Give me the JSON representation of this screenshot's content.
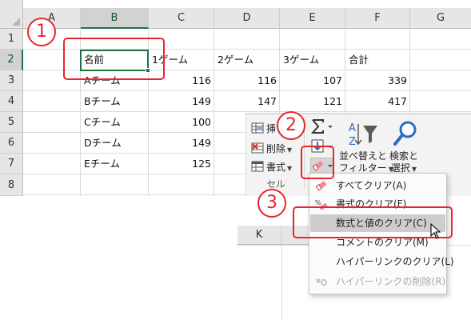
{
  "sheet": {
    "columns": [
      "A",
      "B",
      "C",
      "D",
      "E",
      "F",
      "G"
    ],
    "rows": [
      "1",
      "2",
      "3",
      "4",
      "5",
      "6",
      "7",
      "8"
    ],
    "header_row": [
      "名前",
      "1ゲーム",
      "2ゲーム",
      "3ゲーム",
      "合計"
    ],
    "data": [
      [
        "Aチーム",
        "116",
        "116",
        "107",
        "339"
      ],
      [
        "Bチーム",
        "149",
        "147",
        "121",
        "417"
      ],
      [
        "Cチーム",
        "100"
      ],
      [
        "Dチーム",
        "149"
      ],
      [
        "Eチーム",
        "125"
      ]
    ],
    "selected_column": "B",
    "selected_row": "2"
  },
  "ribbon": {
    "insert_label": "挿",
    "delete_label": "削除",
    "format_label": "書式",
    "group_label": "セル",
    "autosum_icon": "sigma-icon",
    "fill_icon": "fill-down-icon",
    "clear_icon": "eraser-icon",
    "sort_filter_label_1": "並べ替えと",
    "sort_filter_label_2": "フィルター",
    "find_select_label_1": "検索と",
    "find_select_label_2": "選択"
  },
  "clear_menu": {
    "items": [
      {
        "label": "すべてクリア(A)",
        "icon": "eraser-icon",
        "enabled": true
      },
      {
        "label": "書式のクリア(F)",
        "icon": "clear-format-icon",
        "enabled": true
      },
      {
        "label": "数式と値のクリア(C)",
        "icon": "",
        "enabled": true,
        "highlighted": true
      },
      {
        "label": "コメントのクリア(M)",
        "icon": "",
        "enabled": true
      },
      {
        "label": "ハイパーリンクのクリア(L)",
        "icon": "",
        "enabled": true
      },
      {
        "label": "ハイパーリンクの削除(R)",
        "icon": "remove-link-icon",
        "enabled": false
      }
    ]
  },
  "sheet_below": {
    "column_k": "K"
  },
  "annotations": {
    "step1": "1",
    "step2": "2",
    "step3": "3",
    "color": "#e8242c"
  },
  "colors": {
    "excel_green": "#217346",
    "header_gray": "#e6e6e6",
    "highlight": "#cdcdcd"
  }
}
